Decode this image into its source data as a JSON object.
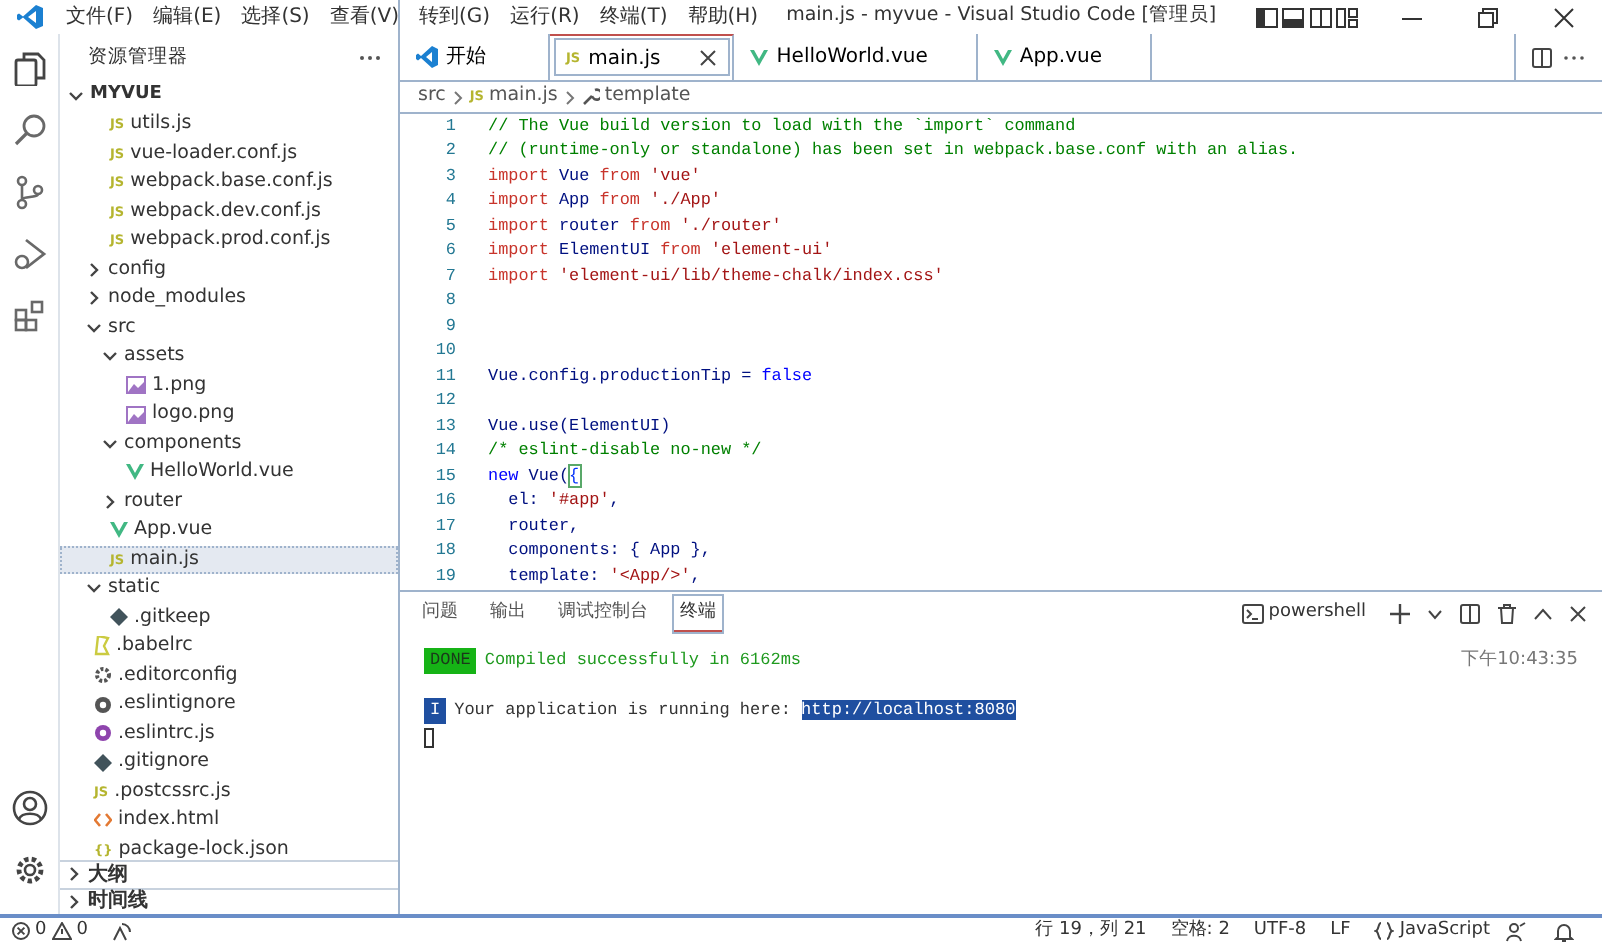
{
  "title_bar": {
    "menu": [
      "文件(F)",
      "编辑(E)",
      "选择(S)",
      "查看(V)",
      "转到(G)",
      "运行(R)",
      "终端(T)",
      "帮助(H)"
    ],
    "title": "main.js - myvue - Visual Studio Code [管理员]"
  },
  "activity_bar": [
    {
      "kind": "files",
      "selected": true
    },
    {
      "kind": "search",
      "selected": false
    },
    {
      "kind": "source-control",
      "selected": false
    },
    {
      "kind": "run",
      "selected": false
    },
    {
      "kind": "extensions",
      "selected": false
    }
  ],
  "sidebar": {
    "title": "资源管理器",
    "root": "MYVUE",
    "tree": [
      {
        "kind": "cut-folder",
        "children": [
          {
            "kind": "js",
            "icon": "JS",
            "label": "utils.js",
            "selected": false
          },
          {
            "kind": "js",
            "icon": "JS",
            "label": "vue-loader.conf.js",
            "selected": false
          },
          {
            "kind": "js",
            "icon": "JS",
            "label": "webpack.base.conf.js",
            "selected": false
          },
          {
            "kind": "js",
            "icon": "JS",
            "label": "webpack.dev.conf.js",
            "selected": false
          },
          {
            "kind": "js",
            "icon": "JS",
            "label": "webpack.prod.conf.js",
            "selected": false
          }
        ]
      },
      {
        "kind": "folder",
        "label": "config",
        "expanded": false,
        "selected": false
      },
      {
        "kind": "folder",
        "label": "node_modules",
        "expanded": false,
        "selected": false
      },
      {
        "kind": "folder",
        "label": "src",
        "expanded": true,
        "selected": false,
        "children": [
          {
            "kind": "folder",
            "label": "assets",
            "expanded": true,
            "selected": false,
            "children": [
              {
                "kind": "image",
                "label": "1.png",
                "selected": false
              },
              {
                "kind": "image",
                "label": "logo.png",
                "selected": false
              }
            ]
          },
          {
            "kind": "folder",
            "label": "components",
            "expanded": true,
            "selected": false,
            "children": [
              {
                "kind": "vue",
                "label": "HelloWorld.vue",
                "selected": false
              }
            ]
          },
          {
            "kind": "folder",
            "label": "router",
            "expanded": false,
            "selected": false
          },
          {
            "kind": "vue",
            "label": "App.vue",
            "selected": false
          },
          {
            "kind": "js",
            "icon": "JS",
            "label": "main.js",
            "selected": true
          }
        ]
      },
      {
        "kind": "folder",
        "label": "static",
        "expanded": true,
        "selected": false,
        "children": [
          {
            "kind": "git",
            "label": ".gitkeep",
            "selected": false
          }
        ]
      },
      {
        "kind": "babel",
        "label": ".babelrc",
        "selected": false
      },
      {
        "kind": "config",
        "label": ".editorconfig",
        "selected": false
      },
      {
        "kind": "ignore",
        "label": ".eslintignore",
        "selected": false
      },
      {
        "kind": "eslint",
        "label": ".eslintrc.js",
        "selected": false
      },
      {
        "kind": "git",
        "label": ".gitignore",
        "selected": false
      },
      {
        "kind": "js",
        "icon": "JS",
        "label": ".postcssrc.js",
        "selected": false
      },
      {
        "kind": "html",
        "label": "index.html",
        "selected": false
      },
      {
        "kind": "json",
        "icon": "{}",
        "label": "package-lock.json",
        "selected": false
      }
    ],
    "sections": [
      {
        "label": "大纲",
        "expanded": false
      },
      {
        "label": "时间线",
        "expanded": false
      }
    ]
  },
  "tabs": [
    {
      "kind": "welcome",
      "label": "开始",
      "selected": false
    },
    {
      "kind": "js",
      "icon": "JS",
      "label": "main.js",
      "selected": true
    },
    {
      "kind": "vue",
      "label": "HelloWorld.vue",
      "selected": false
    },
    {
      "kind": "vue",
      "label": "App.vue",
      "selected": false
    }
  ],
  "breadcrumb": [
    {
      "kind": "folder",
      "label": "src"
    },
    {
      "kind": "js",
      "icon": "JS",
      "label": "main.js"
    },
    {
      "kind": "symbol",
      "label": "template"
    }
  ],
  "code": [
    {
      "number": "1",
      "tokens": [
        {
          "kind": "comment",
          "text": "// The Vue build version to load with the `import` command"
        }
      ]
    },
    {
      "number": "2",
      "tokens": [
        {
          "kind": "comment",
          "text": "// (runtime-only or standalone) has been set in webpack.base.conf with an alias."
        }
      ]
    },
    {
      "number": "3",
      "tokens": [
        {
          "kind": "keyword",
          "text": "import"
        },
        {
          "kind": "plain",
          "text": " Vue "
        },
        {
          "kind": "keyword",
          "text": "from"
        },
        {
          "kind": "string",
          "text": " 'vue'"
        }
      ]
    },
    {
      "number": "4",
      "tokens": [
        {
          "kind": "keyword",
          "text": "import"
        },
        {
          "kind": "plain",
          "text": " App "
        },
        {
          "kind": "keyword",
          "text": "from"
        },
        {
          "kind": "string",
          "text": " './App'"
        }
      ]
    },
    {
      "number": "5",
      "tokens": [
        {
          "kind": "keyword",
          "text": "import"
        },
        {
          "kind": "plain",
          "text": " router "
        },
        {
          "kind": "keyword",
          "text": "from"
        },
        {
          "kind": "string",
          "text": " './router'"
        }
      ]
    },
    {
      "number": "6",
      "tokens": [
        {
          "kind": "keyword",
          "text": "import"
        },
        {
          "kind": "plain",
          "text": " ElementUI "
        },
        {
          "kind": "keyword",
          "text": "from"
        },
        {
          "kind": "string",
          "text": " 'element-ui'"
        }
      ]
    },
    {
      "number": "7",
      "tokens": [
        {
          "kind": "keyword",
          "text": "import"
        },
        {
          "kind": "string",
          "text": " 'element-ui/lib/theme-chalk/index.css'"
        }
      ]
    },
    {
      "number": "8"
    },
    {
      "number": "9"
    },
    {
      "number": "10"
    },
    {
      "number": "11",
      "tokens": [
        {
          "kind": "plain",
          "text": "Vue.config.productionTip = "
        },
        {
          "kind": "constant",
          "text": "false"
        }
      ]
    },
    {
      "number": "12"
    },
    {
      "number": "13",
      "tokens": [
        {
          "kind": "plain",
          "text": "Vue.use(ElementUI)"
        }
      ]
    },
    {
      "number": "14",
      "tokens": [
        {
          "kind": "comment",
          "text": "/* eslint-disable no-new */"
        }
      ]
    },
    {
      "number": "15",
      "tokens": [
        {
          "kind": "constant",
          "text": "new"
        },
        {
          "kind": "plain",
          "text": " Vue("
        },
        {
          "kind": "bracket-match",
          "text": "{"
        }
      ]
    },
    {
      "number": "16",
      "tokens": [
        {
          "kind": "plain",
          "text": "  el: "
        },
        {
          "kind": "string",
          "text": "'#app'"
        },
        {
          "kind": "plain",
          "text": ","
        }
      ]
    },
    {
      "number": "17",
      "tokens": [
        {
          "kind": "plain",
          "text": "  router,"
        }
      ]
    },
    {
      "number": "18",
      "tokens": [
        {
          "kind": "plain",
          "text": "  components: { App },"
        }
      ]
    },
    {
      "number": "19",
      "tokens": [
        {
          "kind": "plain",
          "text": "  template: "
        },
        {
          "kind": "string",
          "text": "'<App/>'"
        },
        {
          "kind": "plain",
          "text": ","
        }
      ]
    }
  ],
  "panel": {
    "tabs": [
      {
        "label": "问题",
        "selected": false
      },
      {
        "label": "输出",
        "selected": false
      },
      {
        "label": "调试控制台",
        "selected": false
      },
      {
        "label": "终端",
        "selected": true
      }
    ],
    "shell": "powershell",
    "terminal": [
      {
        "kind": "done",
        "badge": "DONE",
        "segments": [
          {
            "kind": "success",
            "text": "Compiled successfully in 6162ms"
          }
        ],
        "time": "下午10:43:35"
      },
      {
        "kind": "info",
        "badge": "I",
        "segments": [
          {
            "kind": "plain",
            "text": "Your application is running here: "
          },
          {
            "kind": "selected-link",
            "text": "http://localhost:8080"
          }
        ]
      }
    ]
  },
  "status_bar": {
    "errors": "0",
    "warnings": "0",
    "position": "行 19，列 21",
    "indent": "空格: 2",
    "encoding": "UTF-8",
    "eol": "LF",
    "language": "JavaScript"
  }
}
